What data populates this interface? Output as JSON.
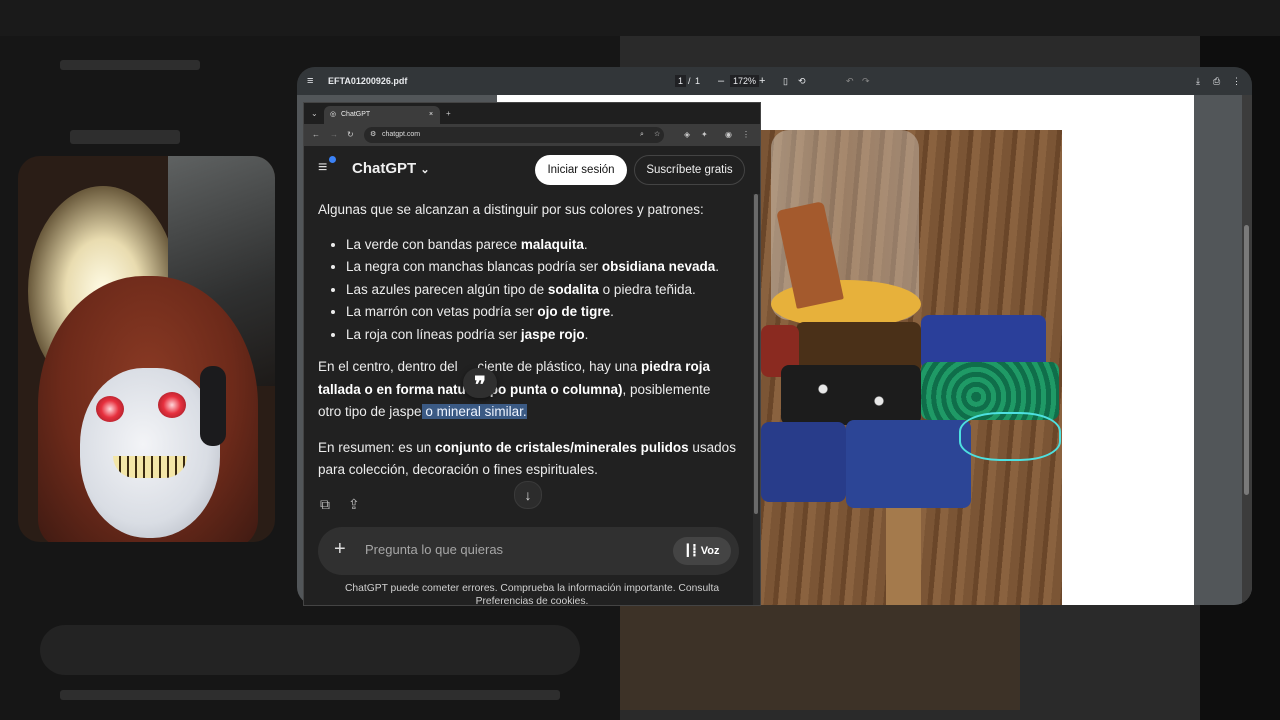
{
  "pdf_viewer": {
    "filename": "EFTA01200926.pdf",
    "page_current": "1",
    "page_sep": "/",
    "page_total": "1",
    "zoom_minus": "–",
    "zoom": "172%",
    "zoom_plus": "+"
  },
  "browser": {
    "tab_title": "ChatGPT",
    "tab_close": "×",
    "new_tab": "+",
    "url": "chatgpt.com"
  },
  "chatgpt": {
    "title": "ChatGPT",
    "login_label": "Iniciar sesión",
    "subscribe_label": "Suscríbete gratis",
    "intro": "Algunas que se alcanzan a distinguir por sus colores y patrones:",
    "list": [
      {
        "pre": "La verde con bandas parece ",
        "bold": "malaquita",
        "post": "."
      },
      {
        "pre": "La negra con manchas blancas podría ser ",
        "bold": "obsidiana nevada",
        "post": "."
      },
      {
        "pre": "Las azules parecen algún tipo de ",
        "bold": "sodalita",
        "post": " o piedra teñida."
      },
      {
        "pre": "La marrón con vetas podría ser ",
        "bold": "ojo de tigre",
        "post": "."
      },
      {
        "pre": "La roja con líneas podría ser ",
        "bold": "jaspe rojo",
        "post": "."
      }
    ],
    "para2": {
      "t1": "En el centro, dentro del ",
      "t2": "ciente de plástico, hay una ",
      "b1": "piedra roja tallada o en forma natu",
      "b2": "po punta o columna)",
      "t3": ", posiblemente otro tipo de jaspe",
      "highlight": " o mineral similar."
    },
    "para3": {
      "t1": "En resumen: es un ",
      "b1": "conjunto de cristales/minerales pulidos",
      "t2": " usados para colección, decoración o fines espirituales."
    },
    "quote_glyph": "❞",
    "scroll_down_glyph": "↓",
    "composer_placeholder": "Pregunta lo que quieras",
    "voice_label": "Voz",
    "footer_line1": "ChatGPT puede cometer errores. Comprueba la información importante. Consulta",
    "footer_line2": "Preferencias de cookies."
  },
  "colors": {
    "highlight": "#3b5a84",
    "chat_bg": "#212121",
    "pdf_toolbar": "#323639"
  }
}
